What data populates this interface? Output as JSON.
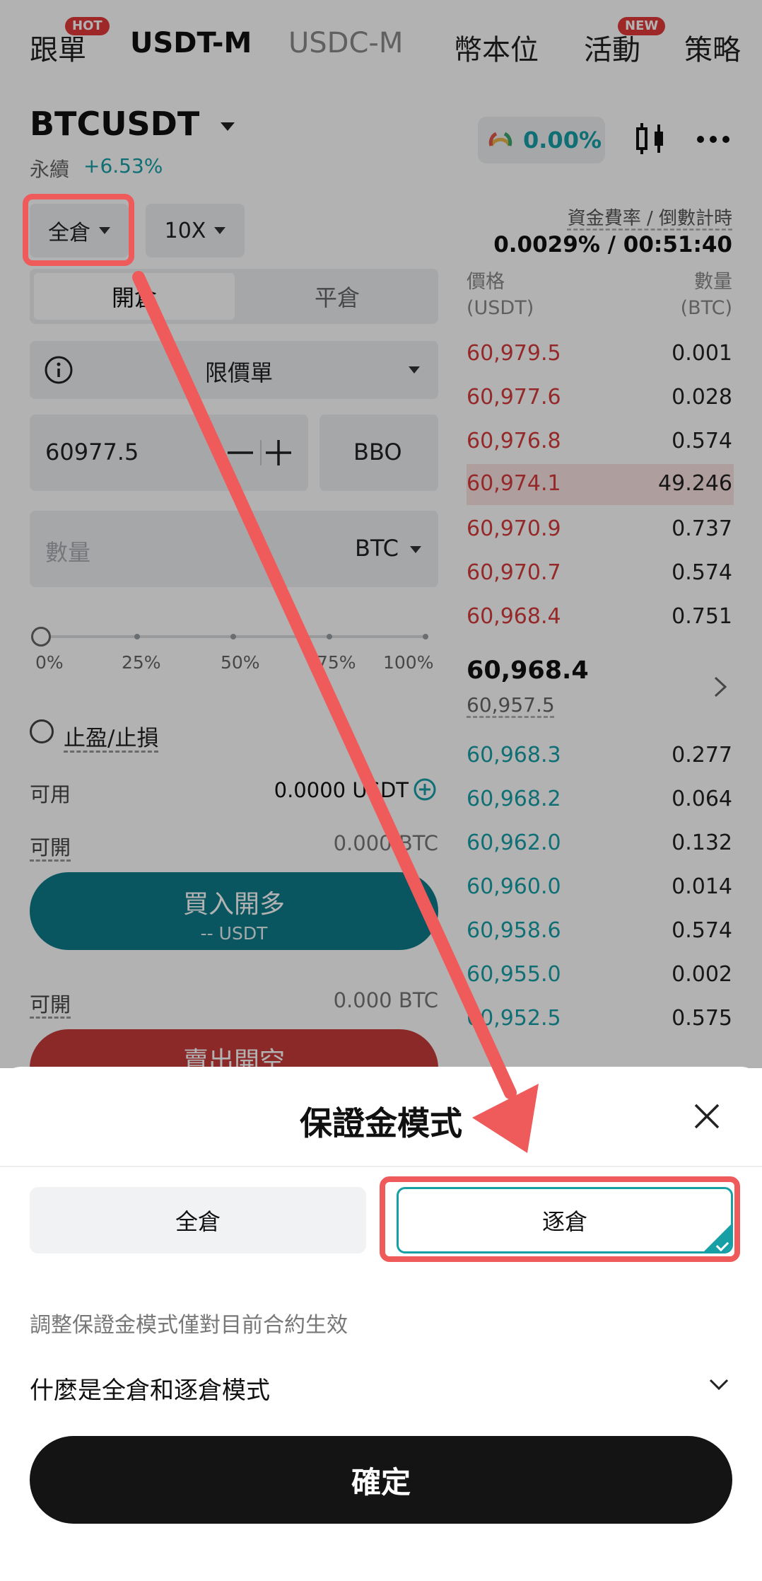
{
  "top_nav": {
    "tabs": [
      {
        "label": "跟單",
        "badge": "HOT"
      },
      {
        "label": "USDT-M"
      },
      {
        "label": "USDC-M"
      },
      {
        "label": "幣本位"
      },
      {
        "label": "活動",
        "badge": "NEW"
      },
      {
        "label": "策略"
      }
    ]
  },
  "symbol": {
    "name": "BTCUSDT",
    "type": "永續",
    "change": "+6.53%",
    "funding_pill_value": "0.00%"
  },
  "controls": {
    "margin_mode": "全倉",
    "leverage": "10X"
  },
  "funding": {
    "label": "資金費率 / 倒數計時",
    "value": "0.0029% / 00:51:40"
  },
  "order_form": {
    "tab_open": "開倉",
    "tab_close": "平倉",
    "order_type": "限價單",
    "price": "60977.5",
    "bbo_label": "BBO",
    "quantity_placeholder": "數量",
    "quantity_unit": "BTC",
    "slider_level_percent": 0,
    "slider_labels": [
      "0%",
      "25%",
      "50%",
      "75%",
      "100%"
    ],
    "tp_sl_label": "止盈/止損",
    "available_label": "可用",
    "available_value": "0.0000 USDT",
    "open_label_1": "可開",
    "open_value_1": "0.000 BTC",
    "buy_label": "買入開多",
    "buy_sub": "-- USDT",
    "open_label_2": "可開",
    "open_value_2": "0.000 BTC",
    "sell_label": "賣出開空"
  },
  "order_book": {
    "header_price": "價格",
    "header_price_unit": "(USDT)",
    "header_qty": "數量",
    "header_qty_unit": "(BTC)",
    "asks": [
      {
        "price": "60,979.5",
        "qty": "0.001"
      },
      {
        "price": "60,977.6",
        "qty": "0.028"
      },
      {
        "price": "60,976.8",
        "qty": "0.574"
      },
      {
        "price": "60,974.1",
        "qty": "49.246"
      },
      {
        "price": "60,970.9",
        "qty": "0.737"
      },
      {
        "price": "60,970.7",
        "qty": "0.574"
      },
      {
        "price": "60,968.4",
        "qty": "0.751"
      }
    ],
    "last_price": "60,968.4",
    "mark_price": "60,957.5",
    "bids": [
      {
        "price": "60,968.3",
        "qty": "0.277"
      },
      {
        "price": "60,968.2",
        "qty": "0.064"
      },
      {
        "price": "60,962.0",
        "qty": "0.132"
      },
      {
        "price": "60,960.0",
        "qty": "0.014"
      },
      {
        "price": "60,958.6",
        "qty": "0.574"
      },
      {
        "price": "60,955.0",
        "qty": "0.002"
      },
      {
        "price": "60,952.5",
        "qty": "0.575"
      }
    ]
  },
  "sheet": {
    "title": "保證金模式",
    "option_cross": "全倉",
    "option_isolated": "逐倉",
    "selected": "逐倉",
    "note": "調整保證金模式僅對目前合約生效",
    "faq": "什麼是全倉和逐倉模式",
    "confirm": "確定"
  },
  "colors": {
    "accent_teal": "#16a0a6",
    "buy": "#0d7c8a",
    "sell": "#c73a3a",
    "ask_red": "#d63b3b",
    "annotation_red": "#ef5a5a"
  }
}
